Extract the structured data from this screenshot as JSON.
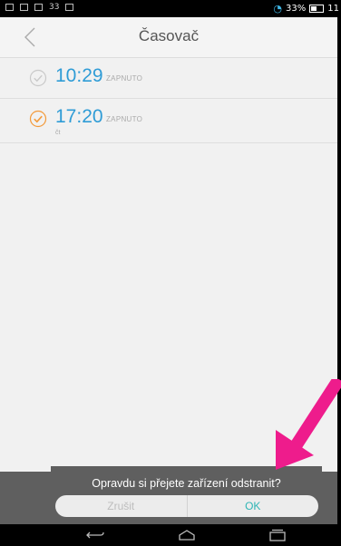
{
  "status_bar": {
    "number": "33",
    "battery": "33%",
    "time_partial": "11"
  },
  "header": {
    "title": "Časovač"
  },
  "timers": [
    {
      "time": "10:29",
      "state": "ZAPNUTO",
      "days": "",
      "checked": false
    },
    {
      "time": "17:20",
      "state": "ZAPNUTO",
      "days": "čt",
      "checked": true
    }
  ],
  "dialog": {
    "message": "Opravdu si přejete zařízení odstranit?",
    "cancel_label": "Zrušit",
    "ok_label": "OK"
  },
  "colors": {
    "accent_blue": "#2f9cd6",
    "check_orange": "#f39a3a",
    "ok_teal": "#2fb5b5",
    "annotation_arrow": "#ee1c8c"
  },
  "icons": [
    "back-icon",
    "check-icon",
    "wifi-icon",
    "battery-icon",
    "nav-back-icon",
    "nav-home-icon",
    "nav-recents-icon",
    "annotation-arrow"
  ]
}
